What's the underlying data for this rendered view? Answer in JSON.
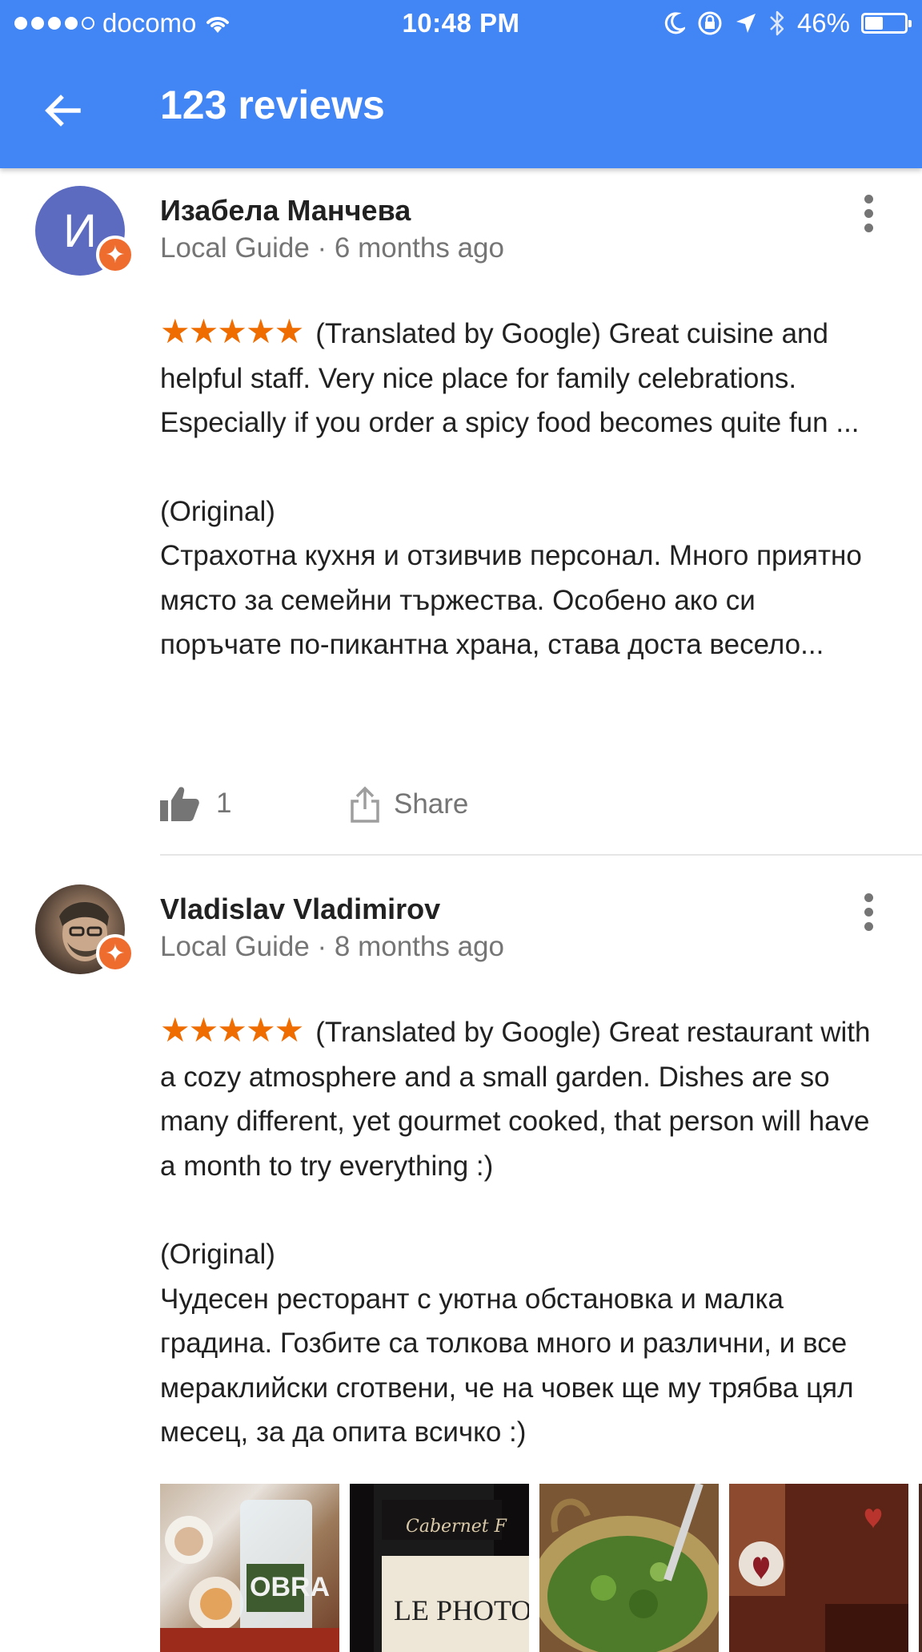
{
  "status_bar": {
    "carrier": "docomo",
    "time": "10:48 PM",
    "battery": "46%",
    "battery_level": 0.46
  },
  "header": {
    "title": "123 reviews"
  },
  "reviews": [
    {
      "avatar_letter": "И",
      "author": "Изабела Манчева",
      "meta": "Local Guide · 6 months ago",
      "rating": 5,
      "stars": "★★★★★",
      "translated": "(Translated by Google) Great cuisine and helpful staff. Very nice place for family celebrations. Especially if you order a spicy food becomes quite fun ...",
      "original_label": "(Original)",
      "original": "Страхотна кухня и отзивчив персонал. Много приятно място за семейни тържества. Особено ако си поръчате по-пикантна храна, става доста весело...",
      "likes": "1",
      "share_label": "Share"
    },
    {
      "author": "Vladislav Vladimirov",
      "meta": "Local Guide · 8 months ago",
      "rating": 5,
      "stars": "★★★★★",
      "translated": "(Translated by Google) Great restaurant with a cozy atmosphere and a small garden. Dishes are so many different, yet gourmet cooked, that person will have a month to try everything :)",
      "original_label": "(Original)",
      "original": "Чудесен ресторант с уютна обстановка и малка градина. Гозбите са толкова много и различни, и все мераклийски сготвени, че на човек ще му трябва цял месец, за да опита всичко :)"
    }
  ],
  "colors": {
    "header": "#4285f4",
    "star": "#ef6c00",
    "badge": "#ef6c2f",
    "avatar": "#5c6bc0"
  },
  "icons": [
    "back-arrow-icon",
    "wifi-icon",
    "moon-icon",
    "rotation-lock-icon",
    "location-arrow-icon",
    "bluetooth-icon",
    "battery-icon",
    "more-vert-icon",
    "thumb-up-icon",
    "share-icon",
    "local-guide-badge-icon"
  ]
}
